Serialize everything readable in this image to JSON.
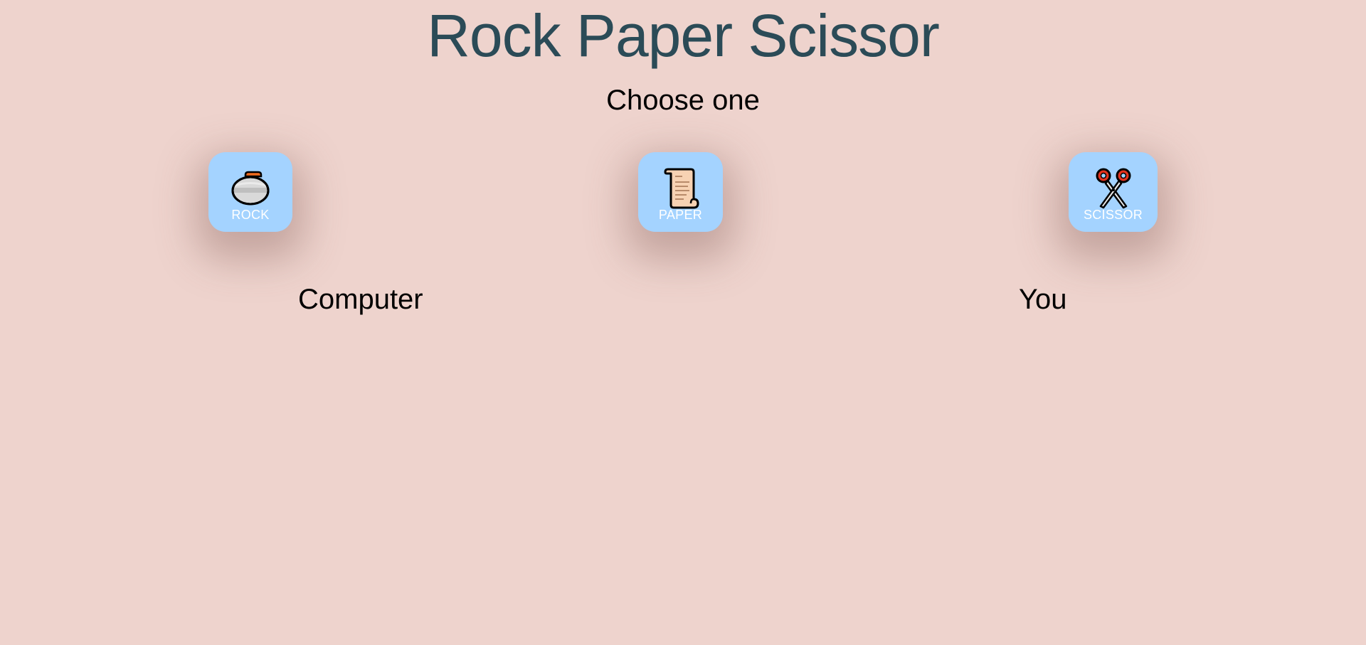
{
  "header": {
    "title": "Rock Paper Scissor",
    "subtitle": "Choose one"
  },
  "choices": [
    {
      "label": "ROCK",
      "icon": "curling-stone-icon"
    },
    {
      "label": "PAPER",
      "icon": "scroll-icon"
    },
    {
      "label": "SCISSOR",
      "icon": "scissors-icon"
    }
  ],
  "players": {
    "computer": "Computer",
    "you": "You"
  },
  "colors": {
    "background": "#eed3cd",
    "title": "#2b4b57",
    "button": "#a4d3ff",
    "button_text": "#ffffff"
  }
}
